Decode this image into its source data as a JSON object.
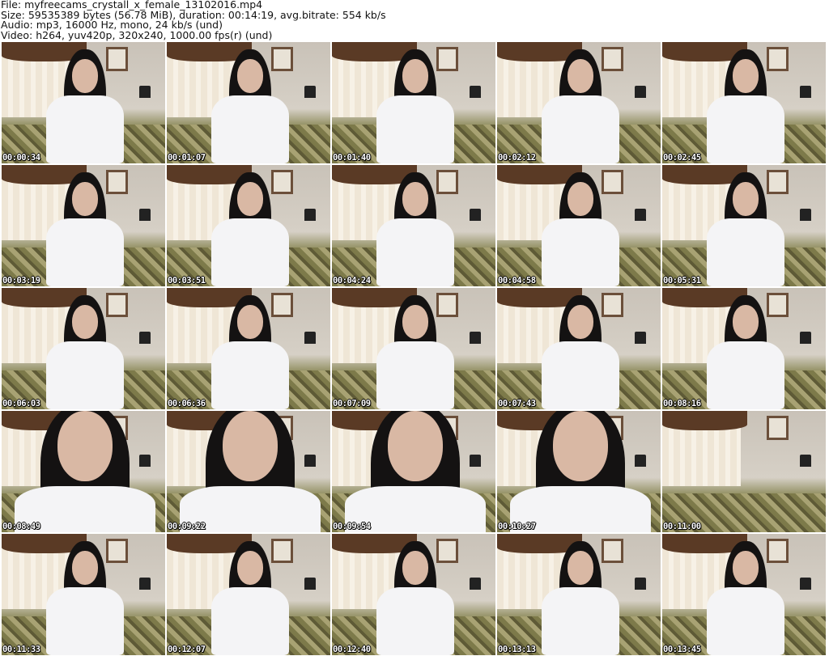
{
  "header": {
    "file": "File: myfreecams_crystall_x_female_13102016.mp4",
    "size": "Size: 59535389 bytes (56.78 MiB), duration: 00:14:19, avg.bitrate: 554 kb/s",
    "audio": "Audio: mp3, 16000 Hz, mono, 24 kb/s (und)",
    "video": "Video: h264, yuv420p, 320x240, 1000.00 fps(r) (und)"
  },
  "thumbnails": [
    {
      "time": "00:00:34"
    },
    {
      "time": "00:01:07"
    },
    {
      "time": "00:01:40"
    },
    {
      "time": "00:02:12"
    },
    {
      "time": "00:02:45"
    },
    {
      "time": "00:03:19"
    },
    {
      "time": "00:03:51"
    },
    {
      "time": "00:04:24"
    },
    {
      "time": "00:04:58"
    },
    {
      "time": "00:05:31"
    },
    {
      "time": "00:06:03"
    },
    {
      "time": "00:06:36"
    },
    {
      "time": "00:07:09"
    },
    {
      "time": "00:07:43"
    },
    {
      "time": "00:08:16"
    },
    {
      "time": "00:08:49"
    },
    {
      "time": "00:09:22"
    },
    {
      "time": "00:09:54"
    },
    {
      "time": "00:10:27"
    },
    {
      "time": "00:11:00"
    },
    {
      "time": "00:11:33"
    },
    {
      "time": "00:12:07"
    },
    {
      "time": "00:12:40"
    },
    {
      "time": "00:13:13"
    },
    {
      "time": "00:13:45"
    }
  ]
}
